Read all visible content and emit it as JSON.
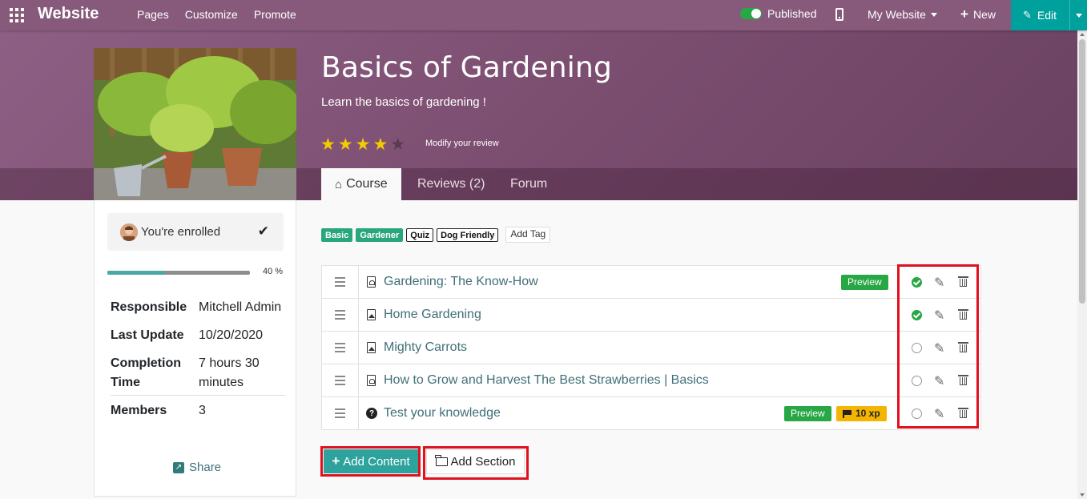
{
  "navbar": {
    "brand": "Website",
    "menu": [
      "Pages",
      "Customize",
      "Promote"
    ],
    "published_label": "Published",
    "my_website_label": "My Website",
    "new_label": "New",
    "edit_label": "Edit"
  },
  "course": {
    "title": "Basics of Gardening",
    "subtitle": "Learn the basics of gardening !",
    "rating": 4,
    "rating_max": 5,
    "review_link": "Modify your review",
    "tabs": [
      {
        "label": "Course"
      },
      {
        "label": "Reviews (2)"
      },
      {
        "label": "Forum"
      }
    ]
  },
  "sidebar": {
    "enrolled_label": "You're enrolled",
    "progress_percent": 40,
    "progress_label": "40 %",
    "info": [
      {
        "key": "Responsible",
        "value": "Mitchell Admin"
      },
      {
        "key": "Last Update",
        "value": "10/20/2020"
      },
      {
        "key": "Completion Time",
        "value": "7 hours 30 minutes"
      },
      {
        "key": "Members",
        "value": "3"
      }
    ],
    "share_label": "Share"
  },
  "tags": {
    "items": [
      {
        "label": "Basic",
        "style": "green"
      },
      {
        "label": "Gardener",
        "style": "green"
      },
      {
        "label": "Quiz",
        "style": "outline"
      },
      {
        "label": "Dog Friendly",
        "style": "outline"
      }
    ],
    "add_label": "Add Tag"
  },
  "contents": [
    {
      "title": "Gardening: The Know-How",
      "icon": "pdf-file-icon",
      "preview": "Preview",
      "xp": "",
      "done": true
    },
    {
      "title": "Home Gardening",
      "icon": "image-file-icon",
      "preview": "",
      "xp": "",
      "done": true
    },
    {
      "title": "Mighty Carrots",
      "icon": "image-file-icon",
      "preview": "",
      "xp": "",
      "done": false
    },
    {
      "title": "How to Grow and Harvest The Best Strawberries | Basics",
      "icon": "pdf-file-icon",
      "preview": "",
      "xp": "",
      "done": false
    },
    {
      "title": "Test your knowledge",
      "icon": "question-circle-icon",
      "preview": "Preview",
      "xp": "10 xp",
      "done": false
    }
  ],
  "actions": {
    "add_content_label": "Add Content",
    "add_section_label": "Add Section"
  },
  "colors": {
    "navbar": "#875a7b",
    "accent": "#00a09d",
    "highlight": "#e0111e",
    "preview_badge": "#28a745",
    "xp_badge": "#f5b400"
  }
}
